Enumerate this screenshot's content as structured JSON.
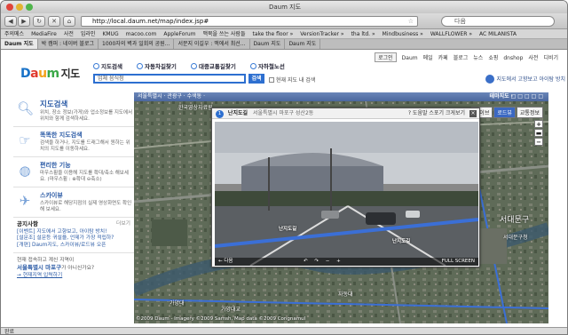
{
  "window": {
    "title": "Daum 지도"
  },
  "nav": {
    "url": "http://local.daum.net/map/index.jsp#",
    "search_placeholder": "다음"
  },
  "bookmarks": [
    "주의메스",
    "MediaFire",
    "사전",
    "입라인",
    "KMUG",
    "macoo.com",
    "AppleForum",
    "맥북을 쓰는 사람들",
    "take the floor »",
    "VersionTracker »",
    "tha ltd. »",
    "Mindbusiness »",
    "WALLFLOWER »",
    "AC MILANISTA"
  ],
  "tabs": [
    "Daum 지도",
    "박 캠퍼 : 네이버 블로그",
    "1000자의 벽과 일회의 공원...",
    "서문지 이길우 : 맥에서 최선...",
    "Daum 지도",
    "Daum 지도"
  ],
  "header": {
    "top_links": [
      "로그인",
      "Daum",
      "메일",
      "카페",
      "블로그",
      "뉴스",
      "쇼핑",
      "dnshop",
      "사전",
      "디비기"
    ],
    "logo_parts": [
      "D",
      "a",
      "u",
      "m"
    ],
    "logo_suffix": "지도",
    "search_tabs": [
      "지도검색",
      "자동차길찾기",
      "대중교통길찾기",
      "자하철노선"
    ],
    "search_placeholder": "업체 음식점",
    "search_button": "검색",
    "checkbox_label": "현재 지도 내 검색",
    "promo_text": "지도에서 고향보고 아이탐 방치"
  },
  "sidebar": {
    "sections": [
      {
        "title": "지도검색",
        "desc": "위치, 장소 정보(가게)와 업소정보를 지도에서 위치와 함께 검색하세요.",
        "icon": "magnifier-icon"
      },
      {
        "title": "똑똑한 지도검색",
        "desc": "검색을 하거나, 지도를 드래그해서 원하는 위치의 지도를 이동하세요.",
        "icon": "pointer-icon"
      },
      {
        "title": "편리한 기능",
        "desc": "마우스휠을 이용해 지도를 확대/축소 해보세요. (마우스휠 : ⊕확대 ⊖축소)",
        "icon": "mouse-icon"
      },
      {
        "title": "스카이뷰",
        "desc": "스카이뷰로 해당지점의 실제 영상화면도 확인해 보세요.",
        "icon": "airplane-icon"
      }
    ],
    "notice_title": "공지사항",
    "notice_more": "더보기",
    "notices": [
      "[이벤트] 지도에서 고향보고, 아이탐 방치!",
      "[설문조] 설문등 귀설을, 언제가 가장 적립하?",
      "[개편] Daum지도, 스카이뷰/로드뷰 오픈"
    ],
    "loc_intro": "현재 접속하고 계신 지역이",
    "loc_place": "서울특별시 마포구",
    "loc_suffix": "가 아니신가요?",
    "loc_link": "→ 현재지역 입력하기"
  },
  "map": {
    "toolbar_left": "서울특별시 · 관광구 · 수색동 ·",
    "toolbar_right": "테마지도 ·",
    "types": [
      "하이브",
      "로드뷰",
      "교통정보"
    ],
    "labels": [
      "한국영상자료원",
      "서대문구",
      "서대문구청",
      "가양대교",
      "가양대",
      "자동대"
    ],
    "copyright": "©2009 Daum - Imagery ©2009 Samsh, Map data ©2009 Congnamul"
  },
  "roadview": {
    "title": "난지도길",
    "address": "서울특별시 마포구 성산2동",
    "tools": [
      "? 도움말",
      "스포기",
      "크게보기"
    ],
    "street_labels": [
      "난지도길",
      "난지도길"
    ],
    "footer_left": "← 다음",
    "footer_right": "FULL SCREEN"
  },
  "status": {
    "text": "완료"
  }
}
